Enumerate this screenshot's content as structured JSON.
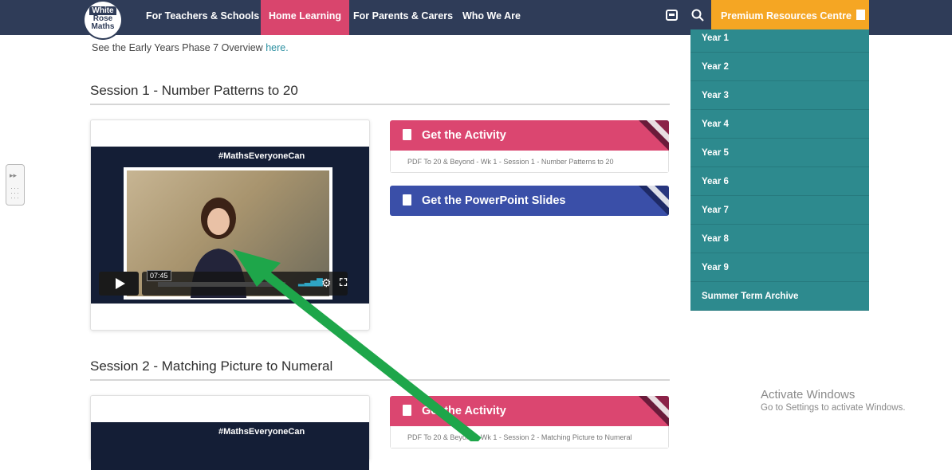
{
  "nav": {
    "logo": {
      "line1": "White",
      "line2": "Rose",
      "line3": "Maths"
    },
    "links": [
      {
        "label": "For Teachers & Schools",
        "active": false
      },
      {
        "label": "Home Learning",
        "active": true
      },
      {
        "label": "For Parents & Carers",
        "active": false
      },
      {
        "label": "Who We Are",
        "active": false
      }
    ],
    "icons": [
      "basket-icon",
      "search-icon"
    ],
    "premium_label": "Premium Resources Centre",
    "premium_icon": "pdf-icon"
  },
  "overview": {
    "prefix": "See the Early Years Phase 7 Overview",
    "link_text": "here.",
    "link_color": "#2a8fa0"
  },
  "sessions": [
    {
      "title": "Session 1 - Number Patterns to 20",
      "video": {
        "hashtag": "#MathsEveryoneCan",
        "time": "07:45"
      },
      "activity": {
        "label": "Get the Activity",
        "file": "PDF To 20 & Beyond - Wk 1 - Session 1 - Number Patterns to 20"
      },
      "powerpoint": {
        "label": "Get the PowerPoint Slides"
      }
    },
    {
      "title": "Session 2 - Matching Picture to Numeral",
      "video": {
        "hashtag": "#MathsEveryoneCan"
      },
      "activity": {
        "label": "Get the Activity",
        "file": "PDF To 20 & Beyond - Wk 1 - Session 2 - Matching Picture to Numeral"
      }
    }
  ],
  "dropdown": [
    "Year 1",
    "Year 2",
    "Year 3",
    "Year 4",
    "Year 5",
    "Year 6",
    "Year 7",
    "Year 8",
    "Year 9",
    "Summer Term Archive"
  ],
  "watermark": {
    "line1": "Activate Windows",
    "line2": "Go to Settings to activate Windows."
  },
  "colors": {
    "nav": "#2f3c58",
    "active": "#d9456d",
    "premium": "#f5a623",
    "dropdown": "#2d8a8e",
    "activity": "#db4670",
    "powerpoint": "#3a4fa8",
    "arrow": "#1ea64a"
  }
}
